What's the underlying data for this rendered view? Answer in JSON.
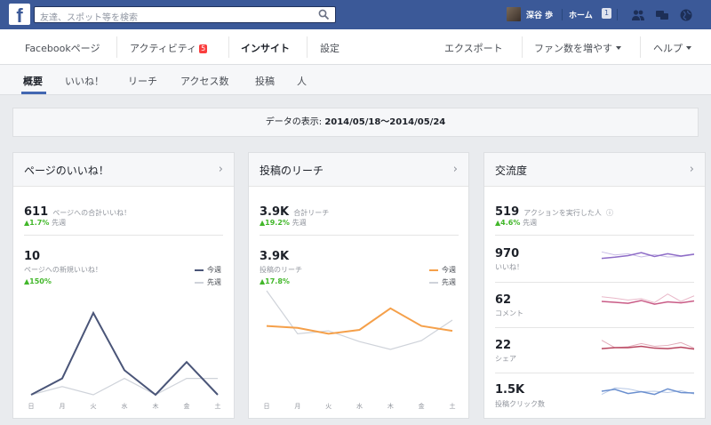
{
  "topbar": {
    "logo": "f",
    "search_placeholder": "友達、スポット等を検索",
    "user_name": "深谷 歩",
    "home_label": "ホーム",
    "home_count": "1"
  },
  "page_nav": {
    "items": [
      {
        "label": "Facebookページ"
      },
      {
        "label": "アクティビティ",
        "badge": "5"
      },
      {
        "label": "インサイト"
      },
      {
        "label": "設定"
      }
    ],
    "right": [
      {
        "label": "エクスポート"
      },
      {
        "label": "ファン数を増やす"
      },
      {
        "label": "ヘルプ"
      }
    ]
  },
  "sub_nav": {
    "items": [
      "概要",
      "いいね！",
      "リーチ",
      "アクセス数",
      "投稿",
      "人"
    ]
  },
  "date_range": {
    "prefix": "データの表示:",
    "range": "2014/05/18〜2014/05/24"
  },
  "cards": {
    "likes": {
      "title": "ページのいいね！",
      "total_value": "611",
      "total_label": "ページへの合計いいね！",
      "total_change": "▲1.7%",
      "total_change_suffix": "先週",
      "new_value": "10",
      "new_label": "ページへの新規いいね！",
      "new_change": "▲150%",
      "legend_this": "今週",
      "legend_last": "先週"
    },
    "reach": {
      "title": "投稿のリーチ",
      "total_value": "3.9K",
      "total_label": "合計リーチ",
      "total_change": "▲19.2%",
      "total_change_suffix": "先週",
      "post_value": "3.9K",
      "post_label": "投稿のリーチ",
      "post_change": "▲17.8%",
      "legend_this": "今週",
      "legend_last": "先週"
    },
    "engagement": {
      "title": "交流度",
      "total_value": "519",
      "total_label": "アクションを実行した人",
      "total_change": "▲4.6%",
      "total_change_suffix": "先週",
      "rows": [
        {
          "value": "970",
          "label": "いいね！"
        },
        {
          "value": "62",
          "label": "コメント"
        },
        {
          "value": "22",
          "label": "シェア"
        },
        {
          "value": "1.5K",
          "label": "投稿クリック数"
        }
      ]
    }
  },
  "days": [
    "日",
    "月",
    "火",
    "水",
    "木",
    "金",
    "土"
  ],
  "colors": {
    "brand": "#3b5998",
    "likes_this_week": "#4a5578",
    "reach_this_week": "#f5a04a",
    "last_week": "#cfd3da",
    "positive": "#42b72a",
    "badge": "#fa3e3e",
    "eng_likes": "#8e6cc7",
    "eng_comments": "#c95b86",
    "eng_shares": "#b8455f",
    "eng_clicks": "#6a8fcf"
  },
  "chart_data": [
    {
      "type": "line",
      "title": "ページへの新規いいね！",
      "x": [
        "日",
        "月",
        "火",
        "水",
        "木",
        "金",
        "土"
      ],
      "ylim": [
        0,
        10
      ],
      "series": [
        {
          "name": "今週",
          "values": [
            0,
            2,
            10,
            3,
            0,
            4,
            0
          ]
        },
        {
          "name": "先週",
          "values": [
            0,
            1,
            0,
            2,
            0,
            2,
            2
          ]
        }
      ]
    },
    {
      "type": "line",
      "title": "投稿のリーチ",
      "x": [
        "日",
        "月",
        "火",
        "水",
        "木",
        "金",
        "土"
      ],
      "ylim": [
        0,
        10
      ],
      "series": [
        {
          "name": "今週",
          "values": [
            6.4,
            6.2,
            5.6,
            6.0,
            8.2,
            6.4,
            5.9
          ]
        },
        {
          "name": "先週",
          "values": [
            10,
            5.6,
            5.9,
            4.8,
            4.0,
            4.9,
            7.0
          ]
        }
      ]
    },
    {
      "type": "line",
      "title": "いいね！",
      "ylim": [
        0,
        10
      ],
      "series": [
        {
          "values": [
            4,
            4.5,
            5.2,
            6.5,
            4.8,
            6,
            5,
            5.8
          ]
        },
        {
          "values": [
            6.8,
            5.5,
            6,
            4.6,
            5.6,
            4.6,
            4.8,
            5.6
          ]
        }
      ]
    },
    {
      "type": "line",
      "title": "コメント",
      "ylim": [
        0,
        10
      ],
      "series": [
        {
          "values": [
            5,
            4.6,
            4.2,
            5.4,
            3.8,
            4.8,
            4.4,
            5.2
          ]
        },
        {
          "values": [
            7,
            6.4,
            5.6,
            6.2,
            4.5,
            8.2,
            5,
            7.4
          ]
        }
      ]
    },
    {
      "type": "line",
      "title": "シェア",
      "ylim": [
        0,
        10
      ],
      "series": [
        {
          "values": [
            4.2,
            4.6,
            4.6,
            5.2,
            4.4,
            4.2,
            4.8,
            4
          ]
        },
        {
          "values": [
            7.8,
            4.6,
            5,
            6.4,
            5.2,
            5.6,
            6.8,
            4.4
          ]
        }
      ]
    },
    {
      "type": "line",
      "title": "投稿クリック数",
      "ylim": [
        0,
        10
      ],
      "series": [
        {
          "values": [
            5.4,
            6.2,
            4.4,
            5.2,
            4,
            6.4,
            4.8,
            4.6
          ]
        },
        {
          "values": [
            4,
            6.8,
            6.4,
            5.2,
            5.4,
            4.8,
            5.6,
            4.2
          ]
        }
      ]
    }
  ]
}
